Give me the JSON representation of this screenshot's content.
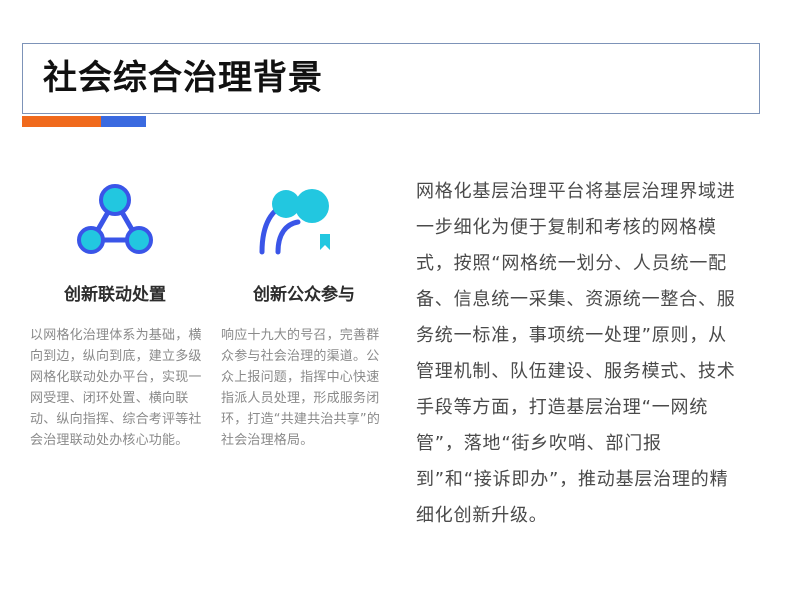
{
  "title": "社会综合治理背景",
  "colors": {
    "accent_orange": "#f06a1d",
    "accent_blue": "#3a6ae0",
    "icon_cyan": "#22c7e0",
    "icon_blue": "#3a55e8",
    "body_text": "#8a8a8a",
    "paragraph_text": "#4a4a4a"
  },
  "features": [
    {
      "icon": "network-nodes-icon",
      "heading": "创新联动处置",
      "body": "以网格化治理体系为基础，横向到边，纵向到底，建立多级网格化联动处办平台，实现一网受理、闭环处置、横向联动、纵向指挥、综合考评等社会治理联动处办核心功能。"
    },
    {
      "icon": "people-participation-icon",
      "heading": "创新公众参与",
      "body": "响应十九大的号召，完善群众参与社会治理的渠道。公众上报问题，指挥中心快速指派人员处理，形成服务闭环，打造“共建共治共享”的社会治理格局。"
    }
  ],
  "paragraph": "网格化基层治理平台将基层治理界域进一步细化为便于复制和考核的网格模式，按照“网格统一划分、人员统一配备、信息统一采集、资源统一整合、服务统一标准，事项统一处理”原则，从管理机制、队伍建设、服务模式、技术手段等方面，打造基层治理“一网统管”，落地“街乡吹哨、部门报到”和“接诉即办”，推动基层治理的精细化创新升级。"
}
